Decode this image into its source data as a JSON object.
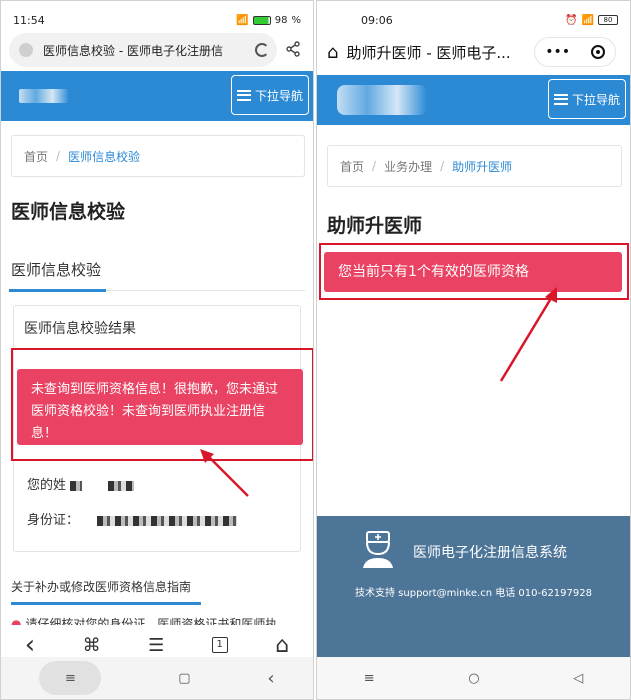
{
  "left": {
    "status": {
      "time": "11:54",
      "battery": "98"
    },
    "url": "医师信息校验 - 医师电子化注册信",
    "nav_button": "下拉导航",
    "breadcrumb": {
      "home": "首页",
      "sep": "/",
      "current": "医师信息校验"
    },
    "page_title": "医师信息校验",
    "tab_label": "医师信息校验",
    "result_title": "医师信息校验结果",
    "alert": "未查询到医师资格信息！很抱歉，您未通过医师资格校验！未查询到医师执业注册信息！",
    "name_label": "您的姓",
    "id_label": "身份证：",
    "guide_title": "关于补办或修改医师资格信息指南",
    "guide_text": "请仔细核对您的身份证、医师资格证书和医师执",
    "bottom_nav": {
      "back": "‹",
      "share": "⌘",
      "menu": "☰",
      "tabs": "1",
      "home": "⌂"
    },
    "system_nav": {
      "menu": "≡",
      "home": "▢",
      "back": "‹"
    }
  },
  "right": {
    "status": {
      "time": "09:06",
      "battery": "80"
    },
    "title": "助师升医师 - 医师电子...",
    "nav_button": "下拉导航",
    "breadcrumb": {
      "home": "首页",
      "sep1": "/",
      "mid": "业务办理",
      "sep2": "/",
      "current": "助师升医师"
    },
    "page_title": "助师升医师",
    "alert": "您当前只有1个有效的医师资格",
    "footer": {
      "system": "医师电子化注册信息系统",
      "support": "技术支持 support@minke.cn 电话 010-62197928"
    },
    "system_nav": {
      "menu": "≡",
      "home": "○",
      "back": "◁"
    }
  },
  "colors": {
    "brand_blue": "#2c8ad5",
    "alert_red": "#ea4262",
    "highlight_red": "#d8182a",
    "footer": "#4d7598"
  }
}
